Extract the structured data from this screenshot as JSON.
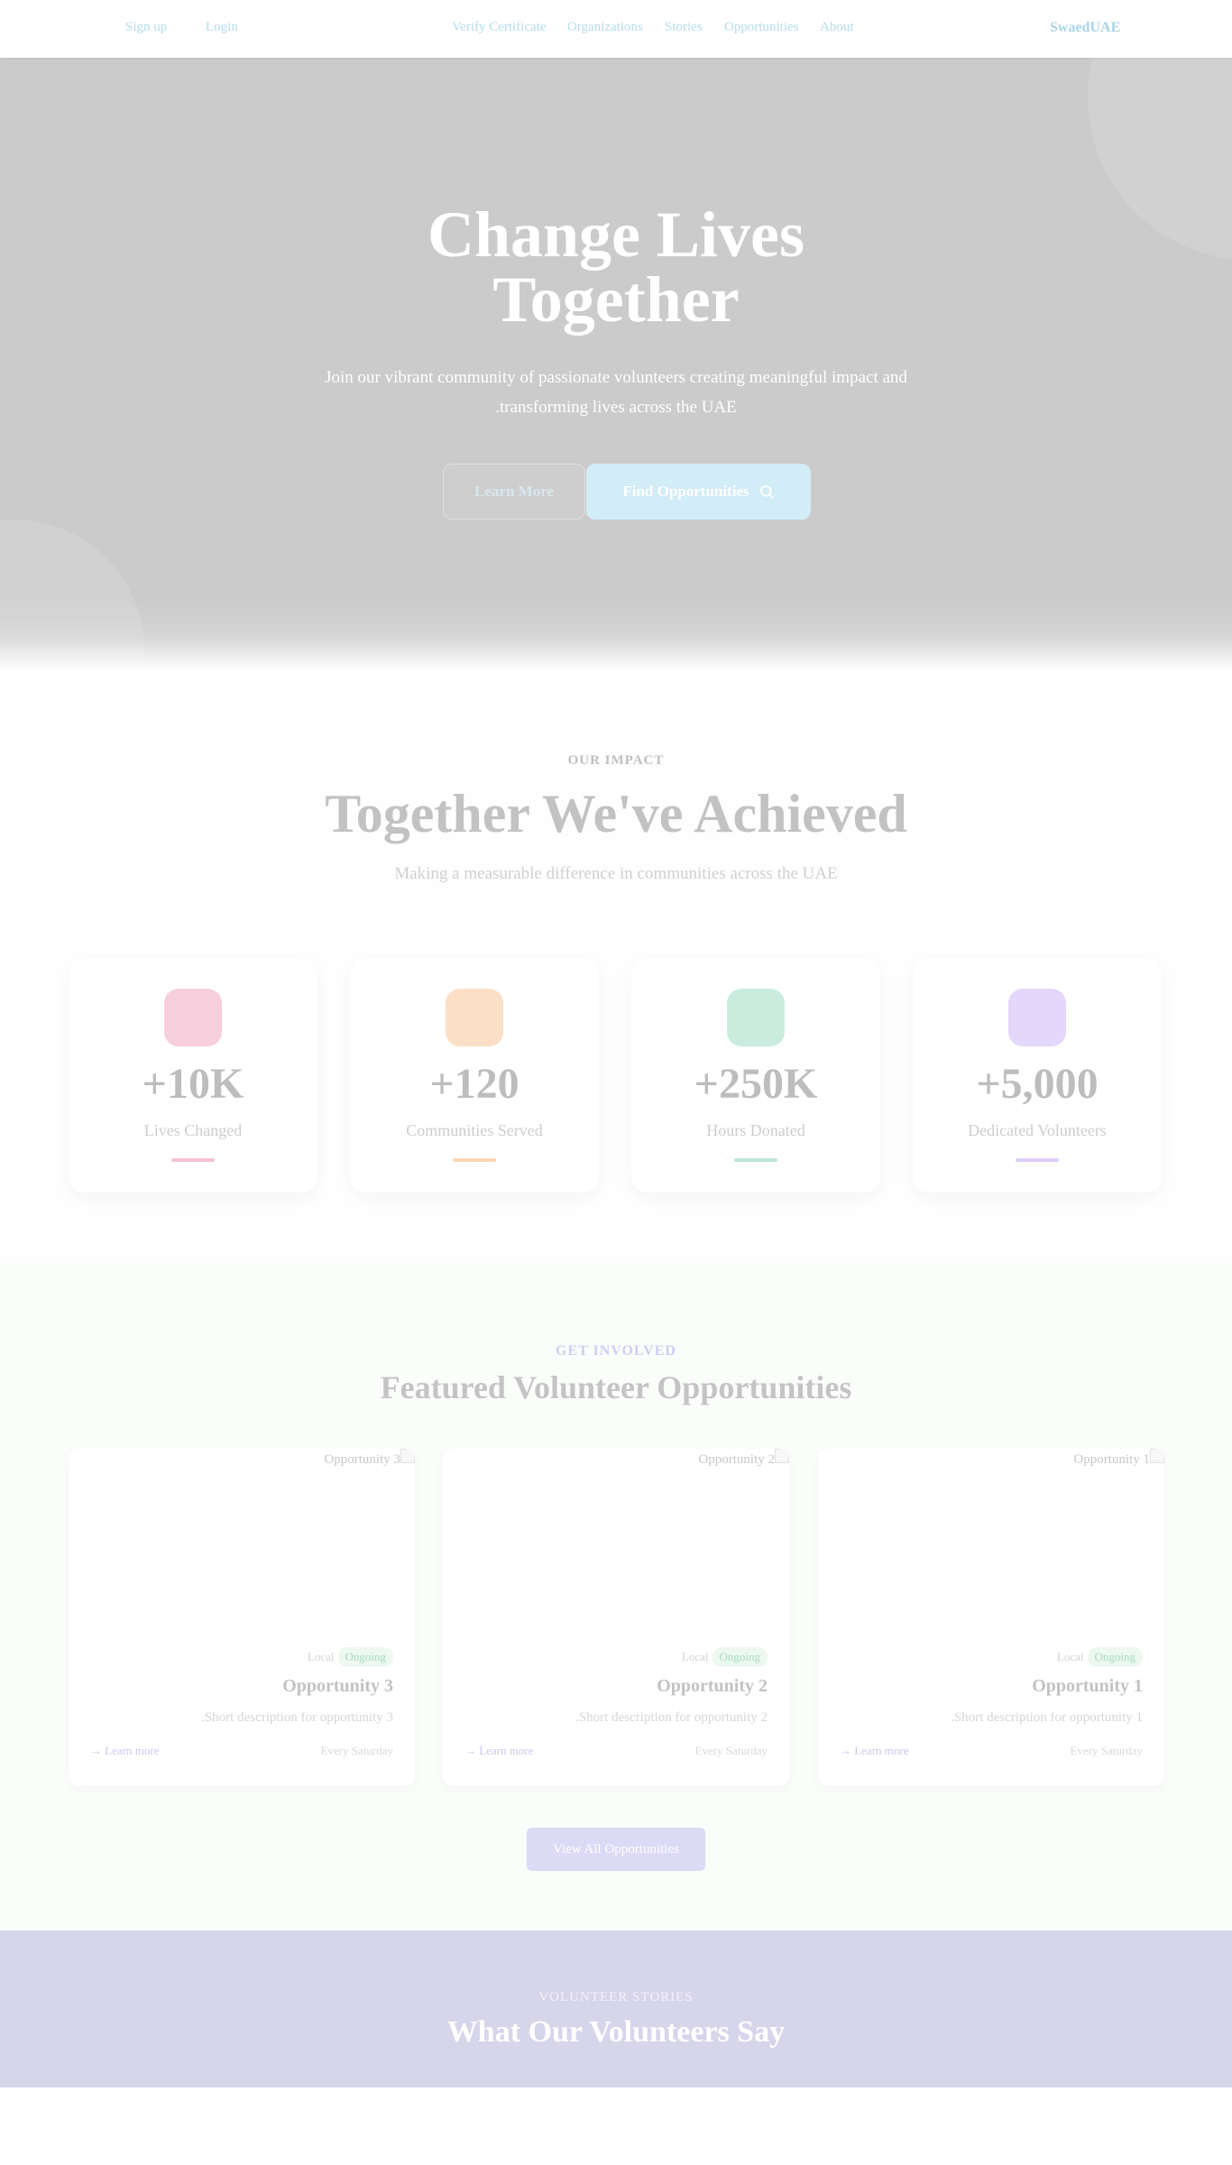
{
  "nav": {
    "signup": "Sign up",
    "login": "Login",
    "links": [
      "Verify Certificate",
      "Organizations",
      "Stories",
      "Opportunities",
      "About"
    ],
    "brand": "SwaedUAE"
  },
  "hero": {
    "title_line1": "Change Lives",
    "title_line2": "Together",
    "subtitle_line1": "Join our vibrant community of passionate volunteers creating meaningful impact and",
    "subtitle_line2": "transforming lives across the UAE.",
    "learn_more": "Learn More",
    "find_opportunities": "Find Opportunities"
  },
  "impact": {
    "eyebrow": "OUR IMPACT",
    "title": "Together We've Achieved",
    "lead": "Making a measurable difference in communities across the UAE",
    "stats": [
      {
        "value": "+10K",
        "label": "Lives Changed",
        "color": "#f7cfdc"
      },
      {
        "value": "+120",
        "label": "Communities Served",
        "color": "#fbdfc6"
      },
      {
        "value": "+250K",
        "label": "Hours Donated",
        "color": "#c9ecdf"
      },
      {
        "value": "+5,000",
        "label": "Dedicated Volunteers",
        "color": "#e3d7fa"
      }
    ]
  },
  "opportunities": {
    "eyebrow": "GET INVOLVED",
    "title": "Featured Volunteer Opportunities",
    "cards": [
      {
        "image_alt": "Opportunity 3",
        "location": "Local",
        "status": "Ongoing",
        "title": "Opportunity 3",
        "description": "Short description for opportunity 3.",
        "learn_more": "→ Learn more",
        "schedule": "Every Saturday"
      },
      {
        "image_alt": "Opportunity 2",
        "location": "Local",
        "status": "Ongoing",
        "title": "Opportunity 2",
        "description": "Short description for opportunity 2.",
        "learn_more": "→ Learn more",
        "schedule": "Every Saturday"
      },
      {
        "image_alt": "Opportunity 1",
        "location": "Local",
        "status": "Ongoing",
        "title": "Opportunity 1",
        "description": "Short description for opportunity 1.",
        "learn_more": "→ Learn more",
        "schedule": "Every Saturday"
      }
    ],
    "view_all": "View All Opportunities"
  },
  "stories": {
    "eyebrow": "VOLUNTEER STORIES",
    "title": "What Our Volunteers Say"
  },
  "icons": {
    "search": "search-icon",
    "broken_image": "broken-image-icon"
  }
}
